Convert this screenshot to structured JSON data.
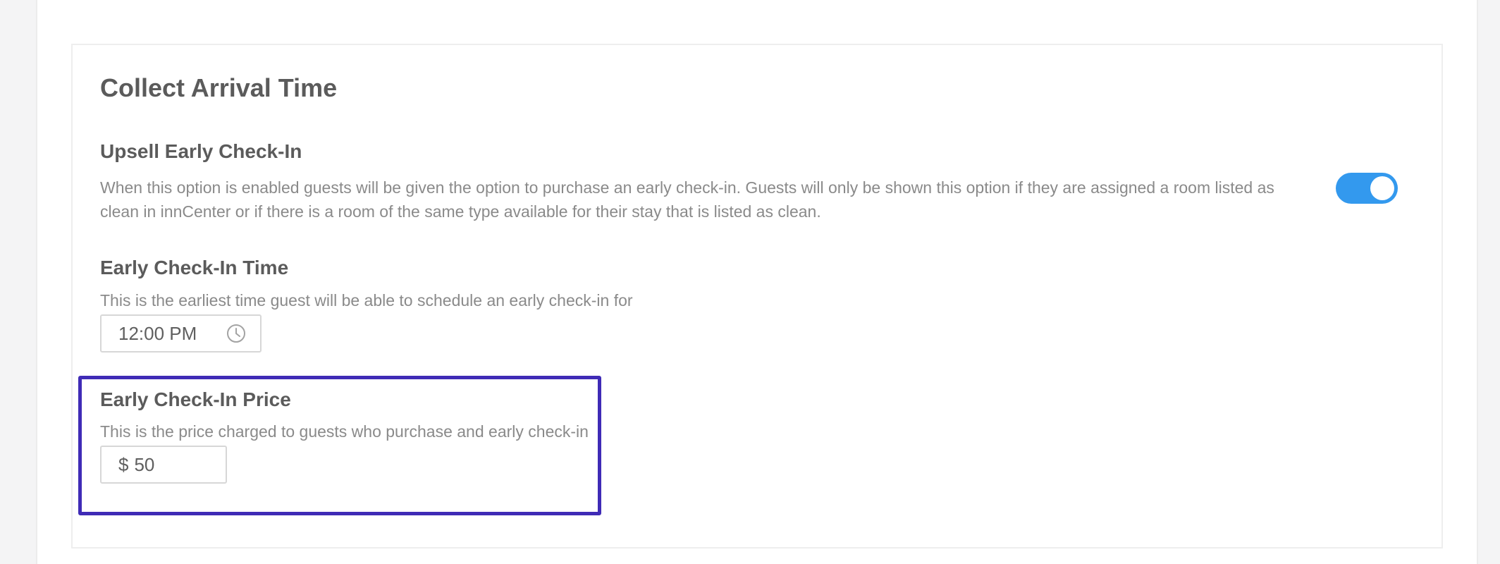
{
  "section": {
    "title": "Collect Arrival Time"
  },
  "upsell": {
    "title": "Upsell Early Check-In",
    "description": "When this option is enabled guests will be given the option to purchase an early check-in. Guests will only be shown this option if they are assigned a room listed as clean in innCenter or if there is a room of the same type available for their stay that is listed as clean.",
    "toggle_enabled": true,
    "toggle_color": "#3399ee"
  },
  "time": {
    "title": "Early Check-In Time",
    "description": "This is the earliest time guest will be able to schedule an early check-in for",
    "value": "12:00 PM",
    "icon": "clock-icon"
  },
  "price": {
    "title": "Early Check-In Price",
    "description": "This is the price charged to guests who purchase and early check-in",
    "currency": "$",
    "value": "50"
  },
  "highlight": {
    "color": "#3f2bb6"
  }
}
